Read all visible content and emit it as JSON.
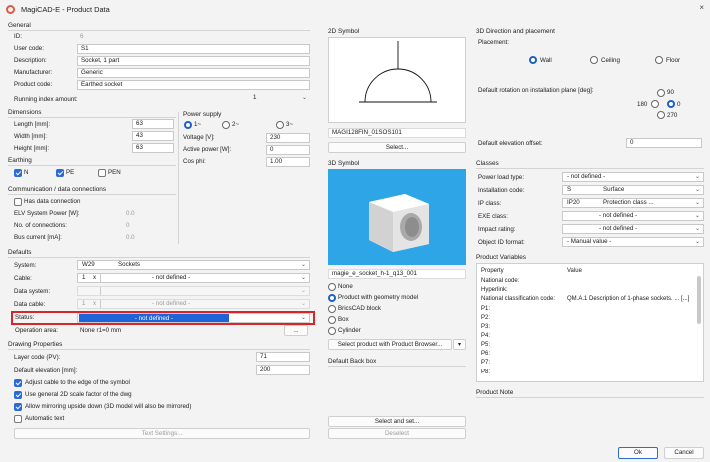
{
  "window": {
    "title": "MagiCAD-E - Product Data",
    "close": "×"
  },
  "general": {
    "heading": "General",
    "id_label": "ID:",
    "id_value": "6",
    "user_code_label": "User code:",
    "user_code_value": "S1",
    "description_label": "Description:",
    "description_value": "Socket, 1 part",
    "manufacturer_label": "Manufacturer:",
    "manufacturer_value": "Generic",
    "product_code_label": "Product code:",
    "product_code_value": "Earthed socket",
    "running_index_label": "Running index amount:",
    "running_index_value": "1"
  },
  "dimensions": {
    "heading": "Dimensions",
    "length_label": "Length [mm]:",
    "length_value": "63",
    "width_label": "Width [mm]:",
    "width_value": "43",
    "height_label": "Height [mm]:",
    "height_value": "63"
  },
  "power": {
    "heading": "Power supply",
    "phase_options": [
      "1~",
      "2~",
      "3~"
    ],
    "voltage_label": "Voltage [V]:",
    "voltage_value": "230",
    "active_label": "Active power [W]:",
    "active_value": "0",
    "cos_label": "Cos phi:",
    "cos_value": "1.00"
  },
  "earthing": {
    "heading": "Earthing",
    "n": "N",
    "pe": "PE",
    "pen": "PEN"
  },
  "comm": {
    "heading": "Communication / data connections",
    "has_data": "Has data connection",
    "elv_label": "ELV System Power [W]:",
    "elv_value": "0.0",
    "conn_label": "No. of connections:",
    "conn_value": "0",
    "bus_label": "Bus current [mA]:",
    "bus_value": "0.0"
  },
  "defaults": {
    "heading": "Defaults",
    "system_label": "System:",
    "system_code": "W29",
    "system_value": "Sockets",
    "cable_label": "Cable:",
    "cable_count": "1",
    "cable_x": "x",
    "cable_value": "- not defined -",
    "data_system_label": "Data system:",
    "data_cable_label": "Data cable:",
    "data_cable_count": "1",
    "data_cable_x": "x",
    "data_cable_value": "- not defined -",
    "status_label": "Status:",
    "status_value": "- not defined -",
    "operation_label": "Operation area:",
    "operation_value": "None r1=0 mm",
    "operation_btn": "..."
  },
  "drawing": {
    "heading": "Drawing Properties",
    "layer_label": "Layer code (PV):",
    "layer_value": "71",
    "elev_label": "Default elevation [mm]:",
    "elev_value": "200",
    "opt1": "Adjust cable to the edge of the symbol",
    "opt2": "Use general 2D scale factor of the dwg",
    "opt3": "Allow mirroring upside down (3D model will also be mirrored)",
    "opt4": "Automatic text",
    "text_settings": "Text Settings..."
  },
  "symbol2d": {
    "heading": "2D Symbol",
    "name": "MAGI128FIN_01SOS101",
    "select": "Select..."
  },
  "symbol3d": {
    "heading": "3D Symbol",
    "name": "magie_e_socket_h-1_q13_001",
    "opt_none": "None",
    "opt_product": "Product with geometry model",
    "opt_brics": "BricsCAD block",
    "opt_box": "Box",
    "opt_cyl": "Cylinder",
    "select_browser": "Select product with Product Browser...",
    "dropdown_arrow": "▾"
  },
  "backbox": {
    "heading": "Default Back box",
    "select_set": "Select and set...",
    "deselect": "Deselect"
  },
  "placement": {
    "heading": "3D Direction and placement",
    "placement_label": "Placement:",
    "wall": "Wall",
    "ceiling": "Ceiling",
    "floor": "Floor",
    "rotation_label": "Default rotation on installation plane [deg]:",
    "rot_90": "90",
    "rot_180": "180",
    "rot_0": "0",
    "rot_270": "270",
    "elev_offset_label": "Default elevation offset:",
    "elev_offset_value": "0"
  },
  "classes": {
    "heading": "Classes",
    "power_load_label": "Power load type:",
    "power_load_value": "- not defined -",
    "install_label": "Installation code:",
    "install_code": "S",
    "install_value": "Surface",
    "ip_label": "IP class:",
    "ip_code": "IP20",
    "ip_value": "Protection class ...",
    "exe_label": "EXE class:",
    "exe_value": "- not defined -",
    "impact_label": "Impact rating:",
    "impact_value": "- not defined -",
    "object_label": "Object ID format:",
    "object_value": "- Manual value -"
  },
  "product_vars": {
    "heading": "Product Variables",
    "col_property": "Property",
    "col_value": "Value",
    "rows": [
      {
        "p": "National code:",
        "v": ""
      },
      {
        "p": "Hyperlink:",
        "v": ""
      },
      {
        "p": "National classification code:",
        "v": "QM.A.1 Description of 1-phase sockets. ... [...]"
      },
      {
        "p": "P1:",
        "v": ""
      },
      {
        "p": "P2:",
        "v": ""
      },
      {
        "p": "P3:",
        "v": ""
      },
      {
        "p": "P4:",
        "v": ""
      },
      {
        "p": "P5:",
        "v": ""
      },
      {
        "p": "P6:",
        "v": ""
      },
      {
        "p": "P7:",
        "v": ""
      },
      {
        "p": "P8:",
        "v": ""
      }
    ]
  },
  "product_note": {
    "heading": "Product Note"
  },
  "footer": {
    "ok": "Ok",
    "cancel": "Cancel"
  }
}
